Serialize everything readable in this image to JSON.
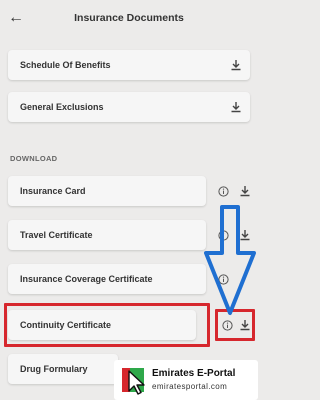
{
  "header": {
    "title": "Insurance Documents",
    "back_icon": "arrow-left-icon"
  },
  "documents": [
    {
      "label": "Schedule Of Benefits"
    },
    {
      "label": "General Exclusions"
    }
  ],
  "download_section": {
    "heading": "DOWNLOAD",
    "items": [
      {
        "label": "Insurance Card"
      },
      {
        "label": "Travel Certificate"
      },
      {
        "label": "Insurance Coverage Certificate"
      },
      {
        "label": "Continuity Certificate"
      },
      {
        "label": "Drug Formulary"
      }
    ]
  },
  "annotation": {
    "highlight_color": "#d6272d",
    "arrow_color": "#1f6fd1"
  },
  "watermark": {
    "title": "Emirates E-Portal",
    "url": "emiratesportal.com"
  },
  "colors": {
    "background": "#ecebea",
    "card": "#f6f6f6",
    "icon": "#444444"
  }
}
